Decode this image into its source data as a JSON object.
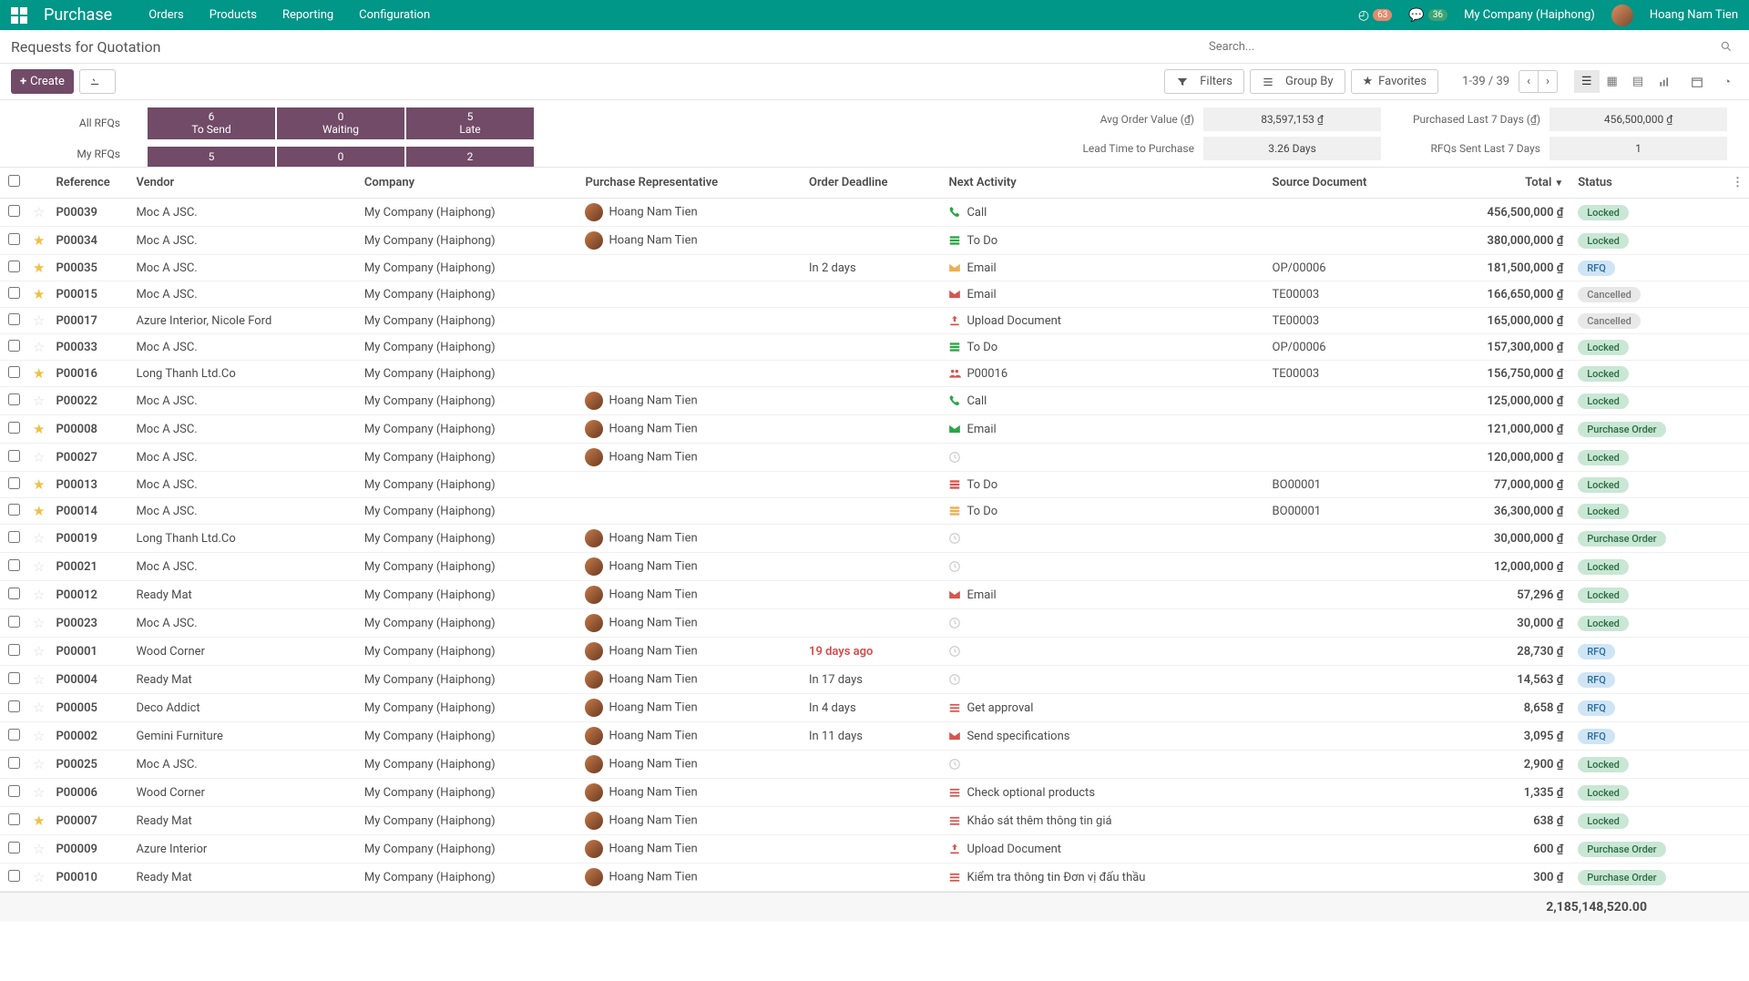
{
  "header": {
    "app_title": "Purchase",
    "menu": [
      "Orders",
      "Products",
      "Reporting",
      "Configuration"
    ],
    "clock_badge": "63",
    "chat_badge": "36",
    "company": "My Company (Haiphong)",
    "user": "Hoang Nam Tien"
  },
  "breadcrumb": "Requests for Quotation",
  "search": {
    "placeholder": "Search..."
  },
  "toolbar": {
    "create": "Create",
    "filters": "Filters",
    "groupby": "Group By",
    "favorites": "Favorites",
    "pager": "1-39 / 39"
  },
  "dashboard": {
    "row_labels": [
      "All RFQs",
      "My RFQs"
    ],
    "top_boxes": [
      {
        "num": "6",
        "label": "To Send"
      },
      {
        "num": "0",
        "label": "Waiting"
      },
      {
        "num": "5",
        "label": "Late"
      }
    ],
    "my_counts": [
      "5",
      "0",
      "2"
    ],
    "stats_left": [
      {
        "label": "Avg Order Value (₫)",
        "value": "83,597,153 ₫"
      },
      {
        "label": "Lead Time to Purchase",
        "value": "3.26  Days"
      }
    ],
    "stats_right": [
      {
        "label": "Purchased Last 7 Days (₫)",
        "value": "456,500,000 ₫"
      },
      {
        "label": "RFQs Sent Last 7 Days",
        "value": "1"
      }
    ]
  },
  "columns": [
    "Reference",
    "Vendor",
    "Company",
    "Purchase Representative",
    "Order Deadline",
    "Next Activity",
    "Source Document",
    "Total",
    "Status"
  ],
  "rows": [
    {
      "star": false,
      "ref": "P00039",
      "vendor": "Moc A JSC.",
      "company": "My Company (Haiphong)",
      "rep": "Hoang Nam Tien",
      "rep_av": true,
      "deadline": "",
      "overdue": false,
      "act_icon": "phone-g",
      "act_text": "Call",
      "source": "",
      "total": "456,500,000 ₫",
      "status": "Locked",
      "st": "locked"
    },
    {
      "star": true,
      "ref": "P00034",
      "vendor": "Moc A JSC.",
      "company": "My Company (Haiphong)",
      "rep": "Hoang Nam Tien",
      "rep_av": true,
      "deadline": "",
      "overdue": false,
      "act_icon": "todo-g",
      "act_text": "To Do",
      "source": "",
      "total": "380,000,000 ₫",
      "status": "Locked",
      "st": "locked"
    },
    {
      "star": true,
      "ref": "P00035",
      "vendor": "Moc A JSC.",
      "company": "My Company (Haiphong)",
      "rep": "",
      "rep_av": false,
      "deadline": "In 2 days",
      "overdue": false,
      "act_icon": "env-y",
      "act_text": "Email",
      "source": "OP/00006",
      "total": "181,500,000 ₫",
      "status": "RFQ",
      "st": "rfq"
    },
    {
      "star": true,
      "ref": "P00015",
      "vendor": "Moc A JSC.",
      "company": "My Company (Haiphong)",
      "rep": "",
      "rep_av": false,
      "deadline": "",
      "overdue": false,
      "act_icon": "env-r",
      "act_text": "Email",
      "source": "TE00003",
      "total": "166,650,000 ₫",
      "status": "Cancelled",
      "st": "cancelled"
    },
    {
      "star": false,
      "ref": "P00017",
      "vendor": "Azure Interior, Nicole Ford",
      "company": "My Company (Haiphong)",
      "rep": "",
      "rep_av": false,
      "deadline": "",
      "overdue": false,
      "act_icon": "upload-r",
      "act_text": "Upload Document",
      "source": "TE00003",
      "total": "165,000,000 ₫",
      "status": "Cancelled",
      "st": "cancelled"
    },
    {
      "star": false,
      "ref": "P00033",
      "vendor": "Moc A JSC.",
      "company": "My Company (Haiphong)",
      "rep": "",
      "rep_av": false,
      "deadline": "",
      "overdue": false,
      "act_icon": "todo-g",
      "act_text": "To Do",
      "source": "OP/00006",
      "total": "157,300,000 ₫",
      "status": "Locked",
      "st": "locked"
    },
    {
      "star": true,
      "ref": "P00016",
      "vendor": "Long Thanh Ltd.Co",
      "company": "My Company (Haiphong)",
      "rep": "",
      "rep_av": false,
      "deadline": "",
      "overdue": false,
      "act_icon": "group-r",
      "act_text": "P00016",
      "source": "TE00003",
      "total": "156,750,000 ₫",
      "status": "Locked",
      "st": "locked"
    },
    {
      "star": false,
      "ref": "P00022",
      "vendor": "Moc A JSC.",
      "company": "My Company (Haiphong)",
      "rep": "Hoang Nam Tien",
      "rep_av": true,
      "deadline": "",
      "overdue": false,
      "act_icon": "phone-g",
      "act_text": "Call",
      "source": "",
      "total": "125,000,000 ₫",
      "status": "Locked",
      "st": "locked"
    },
    {
      "star": true,
      "ref": "P00008",
      "vendor": "Moc A JSC.",
      "company": "My Company (Haiphong)",
      "rep": "Hoang Nam Tien",
      "rep_av": true,
      "deadline": "",
      "overdue": false,
      "act_icon": "env-g",
      "act_text": "Email",
      "source": "",
      "total": "121,000,000 ₫",
      "status": "Purchase Order",
      "st": "po"
    },
    {
      "star": false,
      "ref": "P00027",
      "vendor": "Moc A JSC.",
      "company": "My Company (Haiphong)",
      "rep": "Hoang Nam Tien",
      "rep_av": true,
      "deadline": "",
      "overdue": false,
      "act_icon": "clock",
      "act_text": "",
      "source": "",
      "total": "120,000,000 ₫",
      "status": "Locked",
      "st": "locked"
    },
    {
      "star": true,
      "ref": "P00013",
      "vendor": "Moc A JSC.",
      "company": "My Company (Haiphong)",
      "rep": "",
      "rep_av": false,
      "deadline": "",
      "overdue": false,
      "act_icon": "todo-r",
      "act_text": "To Do",
      "source": "BO00001",
      "total": "77,000,000 ₫",
      "status": "Locked",
      "st": "locked"
    },
    {
      "star": true,
      "ref": "P00014",
      "vendor": "Moc A JSC.",
      "company": "My Company (Haiphong)",
      "rep": "",
      "rep_av": false,
      "deadline": "",
      "overdue": false,
      "act_icon": "todo-y",
      "act_text": "To Do",
      "source": "BO00001",
      "total": "36,300,000 ₫",
      "status": "Locked",
      "st": "locked"
    },
    {
      "star": false,
      "ref": "P00019",
      "vendor": "Long Thanh Ltd.Co",
      "company": "My Company (Haiphong)",
      "rep": "Hoang Nam Tien",
      "rep_av": true,
      "deadline": "",
      "overdue": false,
      "act_icon": "clock",
      "act_text": "",
      "source": "",
      "total": "30,000,000 ₫",
      "status": "Purchase Order",
      "st": "po"
    },
    {
      "star": false,
      "ref": "P00021",
      "vendor": "Moc A JSC.",
      "company": "My Company (Haiphong)",
      "rep": "Hoang Nam Tien",
      "rep_av": true,
      "deadline": "",
      "overdue": false,
      "act_icon": "clock",
      "act_text": "",
      "source": "",
      "total": "12,000,000 ₫",
      "status": "Locked",
      "st": "locked"
    },
    {
      "star": false,
      "ref": "P00012",
      "vendor": "Ready Mat",
      "company": "My Company (Haiphong)",
      "rep": "Hoang Nam Tien",
      "rep_av": true,
      "deadline": "",
      "overdue": false,
      "act_icon": "env-r",
      "act_text": "Email",
      "source": "",
      "total": "57,296 ₫",
      "status": "Locked",
      "st": "locked"
    },
    {
      "star": false,
      "ref": "P00023",
      "vendor": "Moc A JSC.",
      "company": "My Company (Haiphong)",
      "rep": "Hoang Nam Tien",
      "rep_av": true,
      "deadline": "",
      "overdue": false,
      "act_icon": "clock",
      "act_text": "",
      "source": "",
      "total": "30,000 ₫",
      "status": "Locked",
      "st": "locked"
    },
    {
      "star": false,
      "ref": "P00001",
      "vendor": "Wood Corner",
      "company": "My Company (Haiphong)",
      "rep": "Hoang Nam Tien",
      "rep_av": true,
      "deadline": "19 days ago",
      "overdue": true,
      "act_icon": "clock",
      "act_text": "",
      "source": "",
      "total": "28,730 ₫",
      "status": "RFQ",
      "st": "rfq"
    },
    {
      "star": false,
      "ref": "P00004",
      "vendor": "Ready Mat",
      "company": "My Company (Haiphong)",
      "rep": "Hoang Nam Tien",
      "rep_av": true,
      "deadline": "In 17 days",
      "overdue": false,
      "act_icon": "clock",
      "act_text": "",
      "source": "",
      "total": "14,563 ₫",
      "status": "RFQ",
      "st": "rfq"
    },
    {
      "star": false,
      "ref": "P00005",
      "vendor": "Deco Addict",
      "company": "My Company (Haiphong)",
      "rep": "Hoang Nam Tien",
      "rep_av": true,
      "deadline": "In 4 days",
      "overdue": false,
      "act_icon": "list-r",
      "act_text": "Get approval",
      "source": "",
      "total": "8,658 ₫",
      "status": "RFQ",
      "st": "rfq"
    },
    {
      "star": false,
      "ref": "P00002",
      "vendor": "Gemini Furniture",
      "company": "My Company (Haiphong)",
      "rep": "Hoang Nam Tien",
      "rep_av": true,
      "deadline": "In 11 days",
      "overdue": false,
      "act_icon": "env-r",
      "act_text": "Send specifications",
      "source": "",
      "total": "3,095 ₫",
      "status": "RFQ",
      "st": "rfq"
    },
    {
      "star": false,
      "ref": "P00025",
      "vendor": "Moc A JSC.",
      "company": "My Company (Haiphong)",
      "rep": "Hoang Nam Tien",
      "rep_av": true,
      "deadline": "",
      "overdue": false,
      "act_icon": "clock",
      "act_text": "",
      "source": "",
      "total": "2,900 ₫",
      "status": "Locked",
      "st": "locked"
    },
    {
      "star": false,
      "ref": "P00006",
      "vendor": "Wood Corner",
      "company": "My Company (Haiphong)",
      "rep": "Hoang Nam Tien",
      "rep_av": true,
      "deadline": "",
      "overdue": false,
      "act_icon": "list-r",
      "act_text": "Check optional products",
      "source": "",
      "total": "1,335 ₫",
      "status": "Locked",
      "st": "locked"
    },
    {
      "star": true,
      "ref": "P00007",
      "vendor": "Ready Mat",
      "company": "My Company (Haiphong)",
      "rep": "Hoang Nam Tien",
      "rep_av": true,
      "deadline": "",
      "overdue": false,
      "act_icon": "list-r",
      "act_text": "Khảo sát thêm thông tin giá",
      "source": "",
      "total": "638 ₫",
      "status": "Locked",
      "st": "locked"
    },
    {
      "star": false,
      "ref": "P00009",
      "vendor": "Azure Interior",
      "company": "My Company (Haiphong)",
      "rep": "Hoang Nam Tien",
      "rep_av": true,
      "deadline": "",
      "overdue": false,
      "act_icon": "upload-r",
      "act_text": "Upload Document",
      "source": "",
      "total": "600 ₫",
      "status": "Purchase Order",
      "st": "po"
    },
    {
      "star": false,
      "ref": "P00010",
      "vendor": "Ready Mat",
      "company": "My Company (Haiphong)",
      "rep": "Hoang Nam Tien",
      "rep_av": true,
      "deadline": "",
      "overdue": false,
      "act_icon": "list-r",
      "act_text": "Kiểm tra thông tin Đơn vị đấu thầu",
      "source": "",
      "total": "300 ₫",
      "status": "Purchase Order",
      "st": "po"
    }
  ],
  "footer_total": "2,185,148,520.00"
}
